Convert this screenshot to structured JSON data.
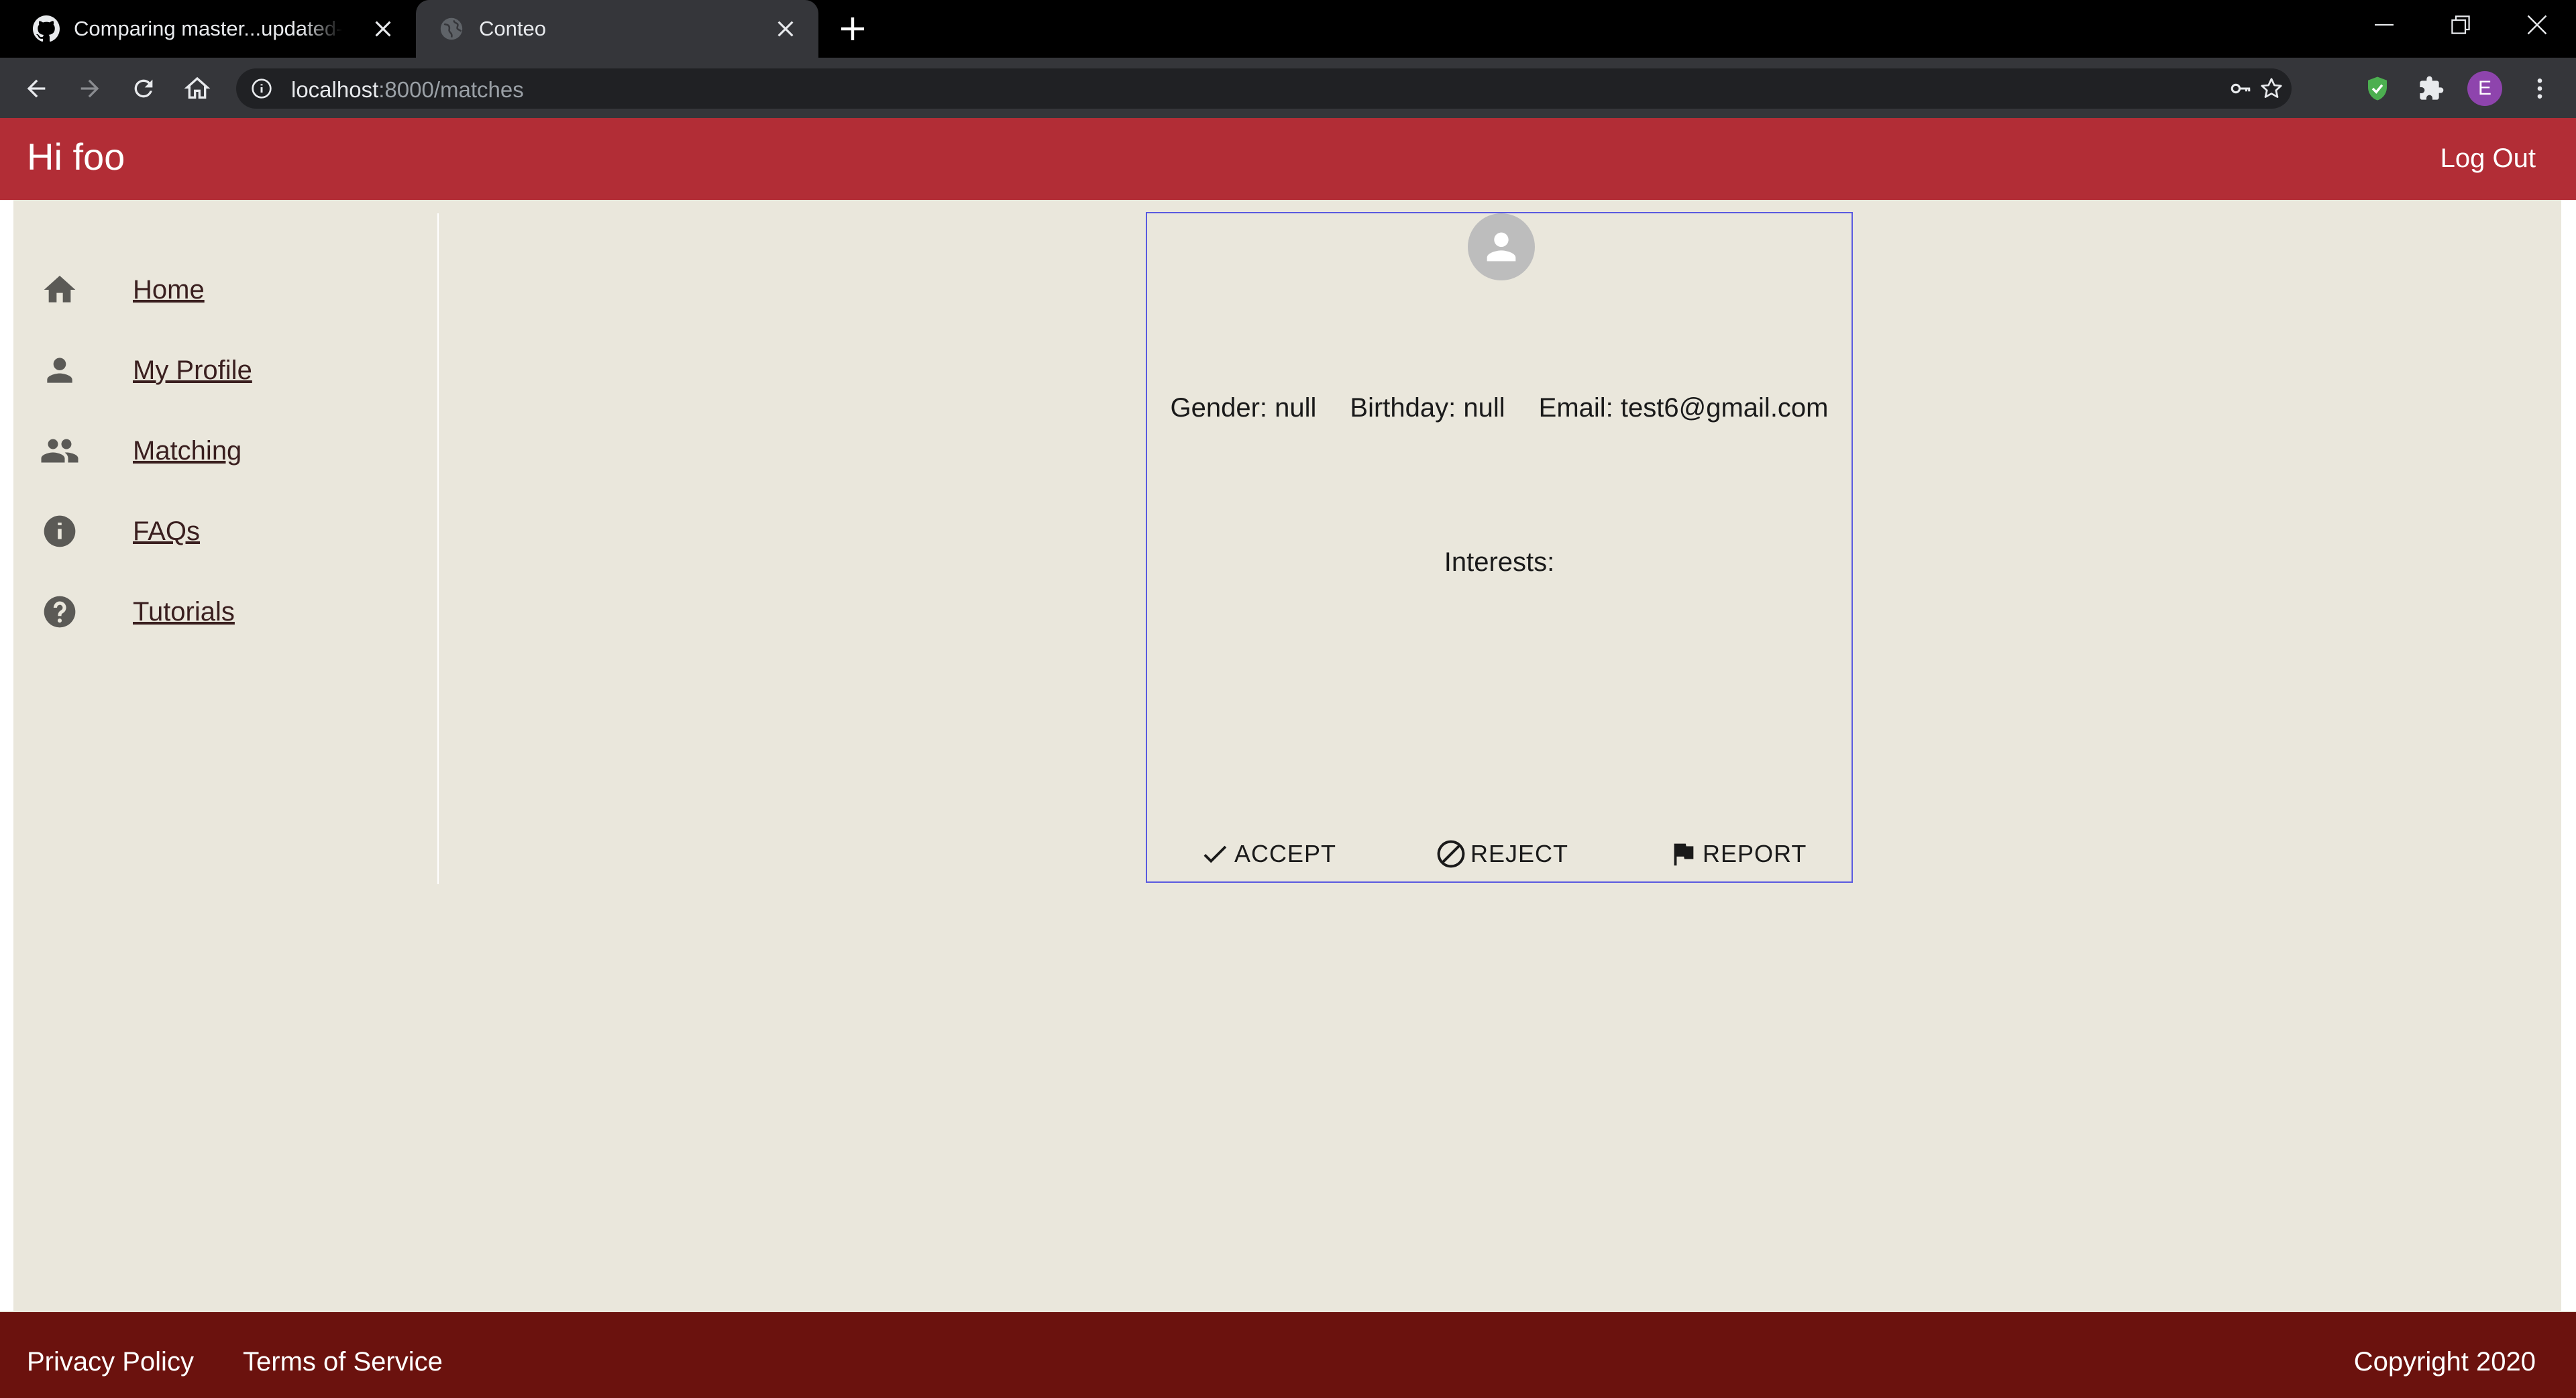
{
  "browser": {
    "tabs": [
      {
        "title": "Comparing master...updated-app"
      },
      {
        "title": "Conteo"
      }
    ],
    "url_host": "localhost",
    "url_path": ":8000/matches",
    "profile_initial": "E"
  },
  "header": {
    "greeting": "Hi foo",
    "logout_label": "Log Out"
  },
  "sidebar": {
    "items": [
      {
        "label": "Home",
        "icon": "home-icon"
      },
      {
        "label": "My Profile",
        "icon": "person-icon"
      },
      {
        "label": "Matching",
        "icon": "people-icon"
      },
      {
        "label": "FAQs",
        "icon": "info-icon"
      },
      {
        "label": "Tutorials",
        "icon": "help-icon"
      }
    ]
  },
  "match_card": {
    "gender": "Gender: null",
    "birthday": "Birthday: null",
    "email": "Email: test6@gmail.com",
    "interests_label": "Interests:",
    "accept_label": "ACCEPT",
    "reject_label": "REJECT",
    "report_label": "REPORT"
  },
  "footer": {
    "privacy": "Privacy Policy",
    "terms": "Terms of Service",
    "copyright": "Copyright 2020"
  },
  "colors": {
    "header": "#b22d36",
    "footer": "#6b120e",
    "background": "#eae7dc",
    "card_border": "#5a5ae0"
  }
}
